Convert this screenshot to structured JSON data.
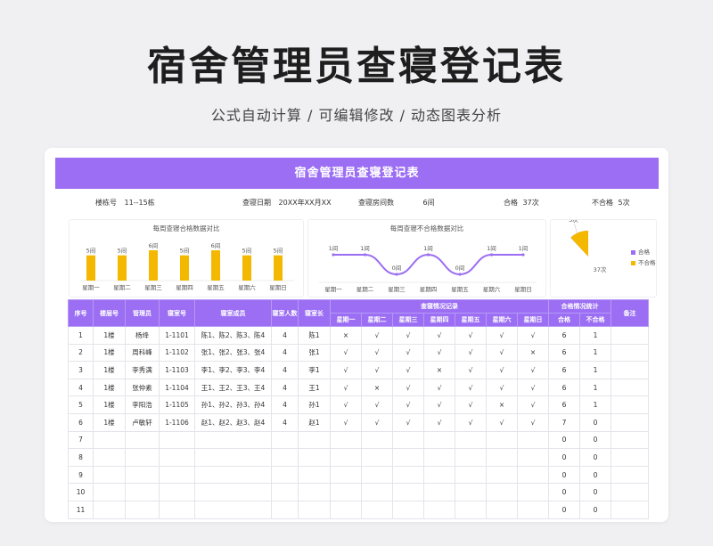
{
  "hero": {
    "title": "宿舍管理员查寝登记表",
    "subtitle": "公式自动计算 /  可编辑修改  / 动态图表分析"
  },
  "sheet": {
    "title": "宿舍管理员查寝登记表",
    "info": {
      "building_label": "楼栋号",
      "building_value": "11--15栋",
      "date_label": "查寝日期",
      "date_value": "20XX年XX月XX",
      "rooms_label": "查寝房间数",
      "rooms_value": "6间",
      "pass_label": "合格",
      "pass_value": "37次",
      "fail_label": "不合格",
      "fail_value": "5次"
    }
  },
  "colors": {
    "accent": "#9b6ef3",
    "bar": "#f5b800",
    "line": "#9b6ef3"
  },
  "chart_data": [
    {
      "type": "bar",
      "title": "每周查寝合格数据对比",
      "categories": [
        "星期一",
        "星期二",
        "星期三",
        "星期四",
        "星期五",
        "星期六",
        "星期日"
      ],
      "values": [
        5,
        5,
        6,
        5,
        6,
        5,
        5
      ],
      "data_labels": [
        "5间",
        "5间",
        "6间",
        "5间",
        "6间",
        "5间",
        "5间"
      ]
    },
    {
      "type": "line",
      "title": "每周查寝不合格数据对比",
      "categories": [
        "星期一",
        "星期二",
        "星期三",
        "星期四",
        "星期五",
        "星期六",
        "星期日"
      ],
      "values": [
        1,
        1,
        0,
        1,
        0,
        1,
        1
      ],
      "data_labels": [
        "1间",
        "1间",
        "0间",
        "1间",
        "0间",
        "1间",
        "1间"
      ]
    },
    {
      "type": "pie",
      "categories": [
        "合格",
        "不合格"
      ],
      "values": [
        37,
        5
      ],
      "data_labels": [
        "37次",
        "5次"
      ],
      "colors": [
        "#9b6ef3",
        "#f5b800"
      ],
      "legend_position": "right"
    }
  ],
  "table": {
    "headers": {
      "seq": "序号",
      "building": "楼层号",
      "manager": "管理员",
      "room": "寝室号",
      "members": "寝室成员",
      "count": "寝室人数",
      "leader": "寝室长",
      "record_group": "查寝情况记录",
      "stat_group": "合格情况统计",
      "note": "备注",
      "days": [
        "星期一",
        "星期二",
        "星期三",
        "星期四",
        "星期五",
        "星期六",
        "星期日"
      ],
      "pass": "合格",
      "fail": "不合格"
    },
    "rows": [
      [
        "1",
        "1楼",
        "杨绛",
        "1-1101",
        "陈1、陈2、陈3、陈4",
        "4",
        "陈1",
        "×",
        "√",
        "√",
        "√",
        "√",
        "√",
        "√",
        "6",
        "1",
        ""
      ],
      [
        "2",
        "1楼",
        "周科峰",
        "1-1102",
        "张1、张2、张3、张4",
        "4",
        "张1",
        "√",
        "√",
        "√",
        "√",
        "√",
        "√",
        "×",
        "6",
        "1",
        ""
      ],
      [
        "3",
        "1楼",
        "李秀满",
        "1-1103",
        "李1、李2、李3、李4",
        "4",
        "李1",
        "√",
        "√",
        "√",
        "×",
        "√",
        "√",
        "√",
        "6",
        "1",
        ""
      ],
      [
        "4",
        "1楼",
        "张仲素",
        "1-1104",
        "王1、王2、王3、王4",
        "4",
        "王1",
        "√",
        "×",
        "√",
        "√",
        "√",
        "√",
        "√",
        "6",
        "1",
        ""
      ],
      [
        "5",
        "1楼",
        "李阳浩",
        "1-1105",
        "孙1、孙2、孙3、孙4",
        "4",
        "孙1",
        "√",
        "√",
        "√",
        "√",
        "√",
        "×",
        "√",
        "6",
        "1",
        ""
      ],
      [
        "6",
        "1楼",
        "卢敏轩",
        "1-1106",
        "赵1、赵2、赵3、赵4",
        "4",
        "赵1",
        "√",
        "√",
        "√",
        "√",
        "√",
        "√",
        "√",
        "7",
        "0",
        ""
      ],
      [
        "7",
        "",
        "",
        "",
        "",
        "",
        "",
        "",
        "",
        "",
        "",
        "",
        "",
        "",
        "0",
        "0",
        ""
      ],
      [
        "8",
        "",
        "",
        "",
        "",
        "",
        "",
        "",
        "",
        "",
        "",
        "",
        "",
        "",
        "0",
        "0",
        ""
      ],
      [
        "9",
        "",
        "",
        "",
        "",
        "",
        "",
        "",
        "",
        "",
        "",
        "",
        "",
        "",
        "0",
        "0",
        ""
      ],
      [
        "10",
        "",
        "",
        "",
        "",
        "",
        "",
        "",
        "",
        "",
        "",
        "",
        "",
        "",
        "0",
        "0",
        ""
      ],
      [
        "11",
        "",
        "",
        "",
        "",
        "",
        "",
        "",
        "",
        "",
        "",
        "",
        "",
        "",
        "0",
        "0",
        ""
      ]
    ]
  }
}
